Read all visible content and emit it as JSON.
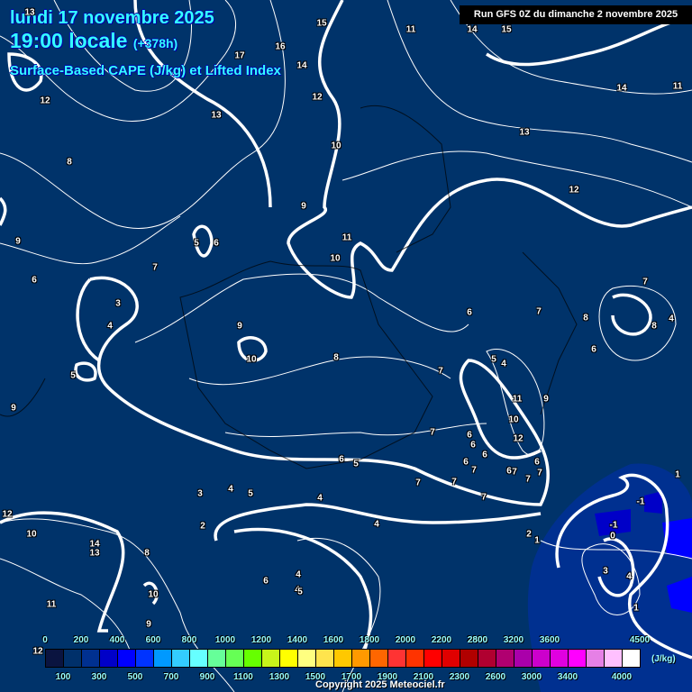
{
  "header": {
    "date": "lundi 17 novembre 2025",
    "time": "19:00 locale",
    "lead": "(+378h)",
    "parameter": "Surface-Based CAPE (J/kg) et Lifted Index",
    "run": "Run GFS 0Z du dimanche 2 novembre 2025"
  },
  "legend": {
    "unit": "(J/kg)",
    "top_labels": [
      "0",
      "200",
      "400",
      "600",
      "800",
      "1000",
      "1200",
      "1400",
      "1600",
      "1800",
      "2000",
      "2200",
      "2400",
      "2800",
      "3200",
      "3600",
      "4500"
    ],
    "bottom_labels": [
      "100",
      "300",
      "500",
      "700",
      "900",
      "1100",
      "1300",
      "1500",
      "1700",
      "1900",
      "2100",
      "2300",
      "2600",
      "3000",
      "3400",
      "4000"
    ],
    "colors": [
      "#0a1440",
      "#00306a",
      "#003090",
      "#0000c8",
      "#0000ff",
      "#0033ff",
      "#0099ff",
      "#33ccff",
      "#66ffff",
      "#66ff99",
      "#66ff55",
      "#66ff00",
      "#c8f51a",
      "#ffff00",
      "#ffff80",
      "#ffe44d",
      "#ffc800",
      "#ff9900",
      "#ff6600",
      "#ff3333",
      "#ff3300",
      "#ff0000",
      "#e00000",
      "#b00000",
      "#b00030",
      "#b00070",
      "#aa00aa",
      "#cc00cc",
      "#e000e0",
      "#ff00ff",
      "#e680e6",
      "#ffc0ff",
      "#ffffff"
    ]
  },
  "lifted_index_labels": [
    "13",
    "12",
    "15",
    "17",
    "16",
    "14",
    "11",
    "14",
    "15",
    "14",
    "11",
    "13",
    "12",
    "13",
    "12",
    "8",
    "10",
    "9",
    "11",
    "10",
    "5",
    "6",
    "7",
    "9",
    "6",
    "3",
    "4",
    "9",
    "10",
    "8",
    "5",
    "9",
    "6",
    "5",
    "4",
    "8",
    "7",
    "7",
    "6",
    "6",
    "6",
    "7",
    "7",
    "6",
    "7",
    "6",
    "7",
    "7",
    "7",
    "7",
    "7",
    "6",
    "5",
    "6",
    "4",
    "4",
    "3",
    "2",
    "4",
    "2",
    "1",
    "5",
    "4",
    "12",
    "10",
    "14",
    "13",
    "8",
    "11",
    "10",
    "9",
    "12",
    "6",
    "4",
    "5",
    "7",
    "8",
    "4",
    "6",
    "1",
    "-1",
    "-1",
    "0",
    "3",
    "4",
    "1",
    "9",
    "11",
    "10",
    "12"
  ],
  "copyright": "Copyright 2025 Meteociel.fr",
  "colors": {
    "background": "#00336a",
    "title": "#33ffff",
    "contour": "#ffffff"
  }
}
